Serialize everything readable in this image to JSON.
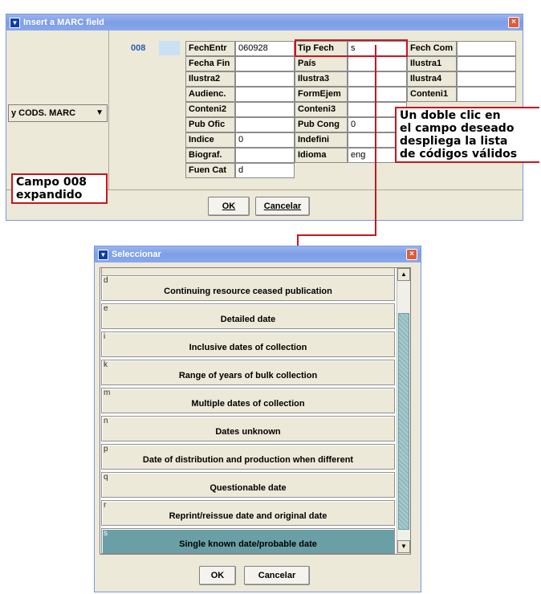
{
  "marc_dialog": {
    "title": "Insert a MARC field",
    "field_tag": "008",
    "dropdown_value": "y CODS. MARC",
    "fields": [
      {
        "label": "FechEntr",
        "value": "060928"
      },
      {
        "label": "Tip Fech",
        "value": "s"
      },
      {
        "label": "Fech Com",
        "value": ""
      },
      {
        "label": "Fecha Fin",
        "value": ""
      },
      {
        "label": "País",
        "value": ""
      },
      {
        "label": "Ilustra1",
        "value": ""
      },
      {
        "label": "Ilustra2",
        "value": ""
      },
      {
        "label": "Ilustra3",
        "value": ""
      },
      {
        "label": "Ilustra4",
        "value": ""
      },
      {
        "label": "Audienc.",
        "value": ""
      },
      {
        "label": "FormEjem",
        "value": ""
      },
      {
        "label": "Conteni1",
        "value": ""
      },
      {
        "label": "Conteni2",
        "value": ""
      },
      {
        "label": "Conteni3",
        "value": ""
      },
      {
        "label": "Pub Ofic",
        "value": ""
      },
      {
        "label": "Pub Cong",
        "value": "0"
      },
      {
        "label": "Indice",
        "value": "0"
      },
      {
        "label": "Indefini",
        "value": ""
      },
      {
        "label": "Biograf.",
        "value": ""
      },
      {
        "label": "Idioma",
        "value": "eng"
      },
      {
        "label": "Fuen Cat",
        "value": "d"
      }
    ],
    "ok_label": "OK",
    "cancel_label": "Cancelar"
  },
  "callouts": {
    "expanded_line1": "Campo 008",
    "expanded_line2": "expandido",
    "hint_line1": "Un doble clic en",
    "hint_line2": "el campo deseado",
    "hint_line3": "despliega la lista",
    "hint_line4": "de códigos válidos"
  },
  "select_dialog": {
    "title": "Seleccionar",
    "items": [
      {
        "code": "d",
        "label": "Continuing resource ceased publication"
      },
      {
        "code": "e",
        "label": "Detailed date"
      },
      {
        "code": "i",
        "label": "Inclusive dates of collection"
      },
      {
        "code": "k",
        "label": "Range of years of bulk collection"
      },
      {
        "code": "m",
        "label": "Multiple dates of collection"
      },
      {
        "code": "n",
        "label": "Dates unknown"
      },
      {
        "code": "p",
        "label": "Date of distribution and production when different"
      },
      {
        "code": "q",
        "label": "Questionable date"
      },
      {
        "code": "r",
        "label": "Reprint/reissue date and original date"
      },
      {
        "code": "s",
        "label": "Single known date/probable date"
      }
    ],
    "selected_code": "s",
    "ok_label": "OK",
    "cancel_label": "Cancelar"
  },
  "colors": {
    "accent_red": "#c8161d",
    "selected_row": "#6a9fa6",
    "titlebar": "#7d9de6"
  }
}
